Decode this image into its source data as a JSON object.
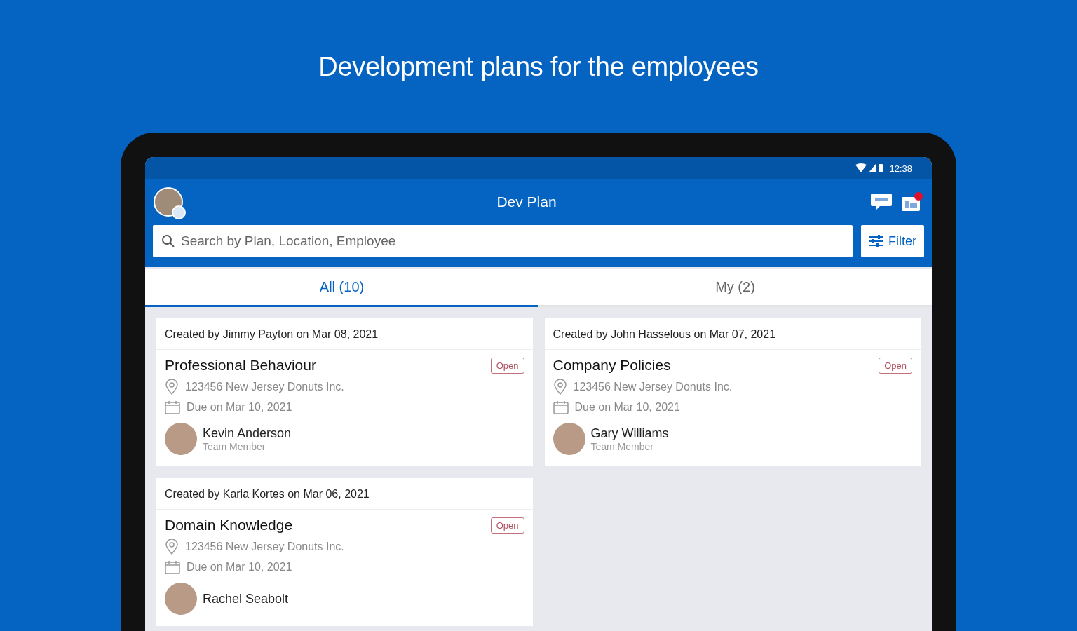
{
  "headline": "Development plans for the employees",
  "status_bar": {
    "time": "12:38"
  },
  "app_bar": {
    "title": "Dev Plan",
    "notification": true
  },
  "search": {
    "placeholder": "Search by Plan, Location, Employee"
  },
  "filter_button": {
    "label": "Filter"
  },
  "tabs": [
    {
      "label": "All (10)",
      "selected": true
    },
    {
      "label": "My (2)",
      "selected": false
    }
  ],
  "plans": [
    {
      "created": "Created by Jimmy Payton on Mar 08, 2021",
      "title": "Professional Behaviour",
      "status": "Open",
      "location": "123456 New Jersey Donuts Inc.",
      "due": "Due on Mar 10, 2021",
      "employee": "Kevin Anderson",
      "role": "Team Member"
    },
    {
      "created": "Created by John Hasselous on Mar 07, 2021",
      "title": "Company Policies",
      "status": "Open",
      "location": "123456 New Jersey Donuts Inc.",
      "due": "Due on Mar 10, 2021",
      "employee": "Gary Williams",
      "role": "Team Member"
    },
    {
      "created": "Created by Karla Kortes on Mar 06, 2021",
      "title": "Domain Knowledge",
      "status": "Open",
      "location": "123456 New Jersey Donuts Inc.",
      "due": "Due on Mar 10, 2021",
      "employee": "Rachel Seabolt"
    }
  ]
}
